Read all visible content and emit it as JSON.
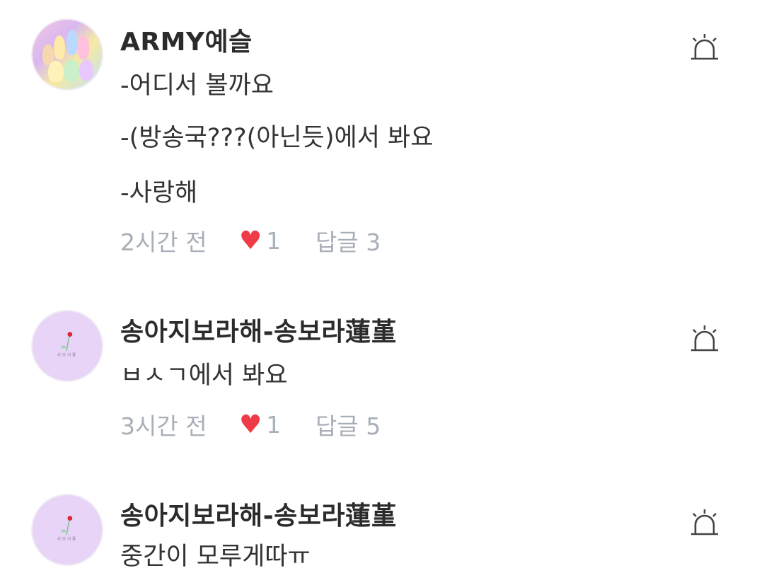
{
  "comments": [
    {
      "username": "ARMY예슬",
      "lines": [
        "-어디서 볼까요",
        "-(방송국???(아닌듯)에서 봐요",
        "-사랑해"
      ],
      "time": "2시간 전",
      "likes": "1",
      "replies_label": "답글 3",
      "avatar": "group-photo-avatar"
    },
    {
      "username": "송아지보라해-송보라蓮堇",
      "lines": [
        "ㅂㅅㄱ에서 봐요"
      ],
      "time": "3시간 전",
      "likes": "1",
      "replies_label": "답글 5",
      "avatar": "flower-avatar",
      "avatar_caption": "서 보 서 퓽"
    },
    {
      "username": "송아지보라해-송보라蓮堇",
      "lines": [
        "중간이 모루게따ㅠ"
      ],
      "avatar": "flower-avatar",
      "avatar_caption": "서 보 서 퓽"
    }
  ],
  "icons": {
    "heart": "heart-icon",
    "report": "siren-report-icon"
  },
  "colors": {
    "heart": "#ef3b47",
    "meta_text": "#a9afb8",
    "username": "#2b2b2b",
    "body_text": "#333333",
    "flower_avatar_bg": "#e7d4f7"
  }
}
